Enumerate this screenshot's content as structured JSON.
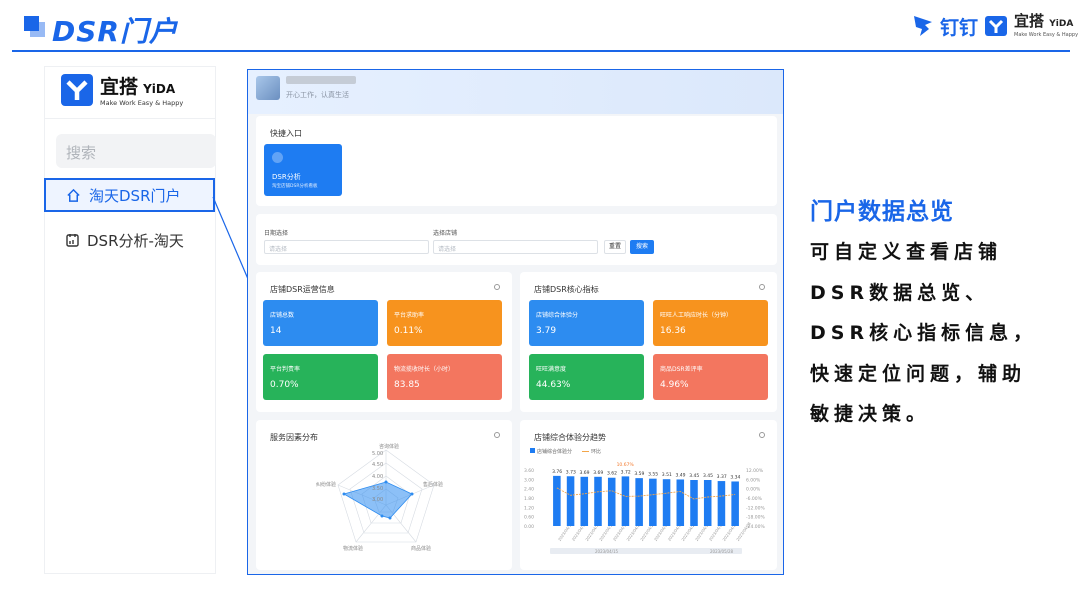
{
  "header": {
    "title": "DSR门户",
    "dingtalk": "钉钉",
    "yida_cn": "宜搭",
    "yida_en": "YiDA",
    "yida_sub": "Make Work Easy & Happy"
  },
  "sidebar": {
    "logo_cn": "宜搭",
    "logo_en": "YiDA",
    "logo_sub": "Make Work Easy & Happy",
    "search_placeholder": "搜索",
    "items": [
      {
        "label": "淘天DSR门户",
        "active": true
      },
      {
        "label": "DSR分析-淘天",
        "active": false
      }
    ]
  },
  "portal": {
    "user_motto": "开心工作，认真生活",
    "quick_entry": {
      "title": "快捷入口",
      "tile_title": "DSR分析",
      "tile_desc": "淘宝店铺DSR分析看板"
    },
    "filter": {
      "date_label": "日期选择",
      "date_placeholder": "请选择",
      "store_label": "选择店铺",
      "store_placeholder": "请选择",
      "reset": "重置",
      "search": "搜索"
    },
    "ops_card": {
      "title": "店铺DSR运营信息",
      "tiles": [
        {
          "label": "店铺总数",
          "value": "14",
          "color": "#2d8cf0"
        },
        {
          "label": "平台求助率",
          "value": "0.11%",
          "color": "#f7931e"
        },
        {
          "label": "平台判责率",
          "value": "0.70%",
          "color": "#27b35a"
        },
        {
          "label": "物流揽收时长（小时）",
          "value": "83.85",
          "color": "#f3765f"
        }
      ]
    },
    "core_card": {
      "title": "店铺DSR核心指标",
      "tiles": [
        {
          "label": "店铺综合体验分",
          "value": "3.79",
          "color": "#2d8cf0"
        },
        {
          "label": "旺旺人工响应时长（分钟）",
          "value": "16.36",
          "color": "#f7931e"
        },
        {
          "label": "旺旺满意度",
          "value": "44.63%",
          "color": "#27b35a"
        },
        {
          "label": "商品DSR差评率",
          "value": "4.96%",
          "color": "#f3765f"
        }
      ]
    },
    "radar_card": {
      "title": "服务因素分布",
      "axes": [
        "咨询体验",
        "售后体验",
        "商品体验",
        "物流体验",
        "纠纷体验"
      ],
      "ticks": [
        "5.00",
        "4.50",
        "4.00",
        "3.50",
        "3.00"
      ]
    },
    "trend_card": {
      "title": "店铺综合体验分趋势",
      "legend": [
        "店铺综合体验分",
        "环比"
      ],
      "bar_labels": [
        "3.76",
        "3.73",
        "3.69",
        "3.69",
        "3.62",
        "3.72",
        "3.59",
        "3.55",
        "3.51",
        "3.49",
        "3.45",
        "3.45",
        "3.37",
        "3.34"
      ],
      "top_label": "10.67%",
      "y_left": [
        "3.60",
        "3.00",
        "2.40",
        "1.80",
        "1.20",
        "0.60",
        "0.00"
      ],
      "y_right": [
        "12.00%",
        "6.00%",
        "0.00%",
        "-6.00%",
        "-12.00%",
        "-18.00%",
        "-24.00%"
      ],
      "slider": [
        "2023/04/15",
        "2023/05/28"
      ]
    }
  },
  "chart_data": {
    "type": "bar",
    "title": "店铺综合体验分趋势",
    "series": [
      {
        "name": "店铺综合体验分",
        "values": [
          3.76,
          3.73,
          3.69,
          3.69,
          3.62,
          3.72,
          3.59,
          3.55,
          3.51,
          3.49,
          3.45,
          3.45,
          3.37,
          3.34
        ]
      }
    ]
  },
  "right_panel": {
    "title": "门户数据总览",
    "body": "可自定义查看店铺DSR数据总览、DSR核心指标信息，快速定位问题，辅助敏捷决策。"
  },
  "colors": {
    "accent": "#1a66e8"
  }
}
